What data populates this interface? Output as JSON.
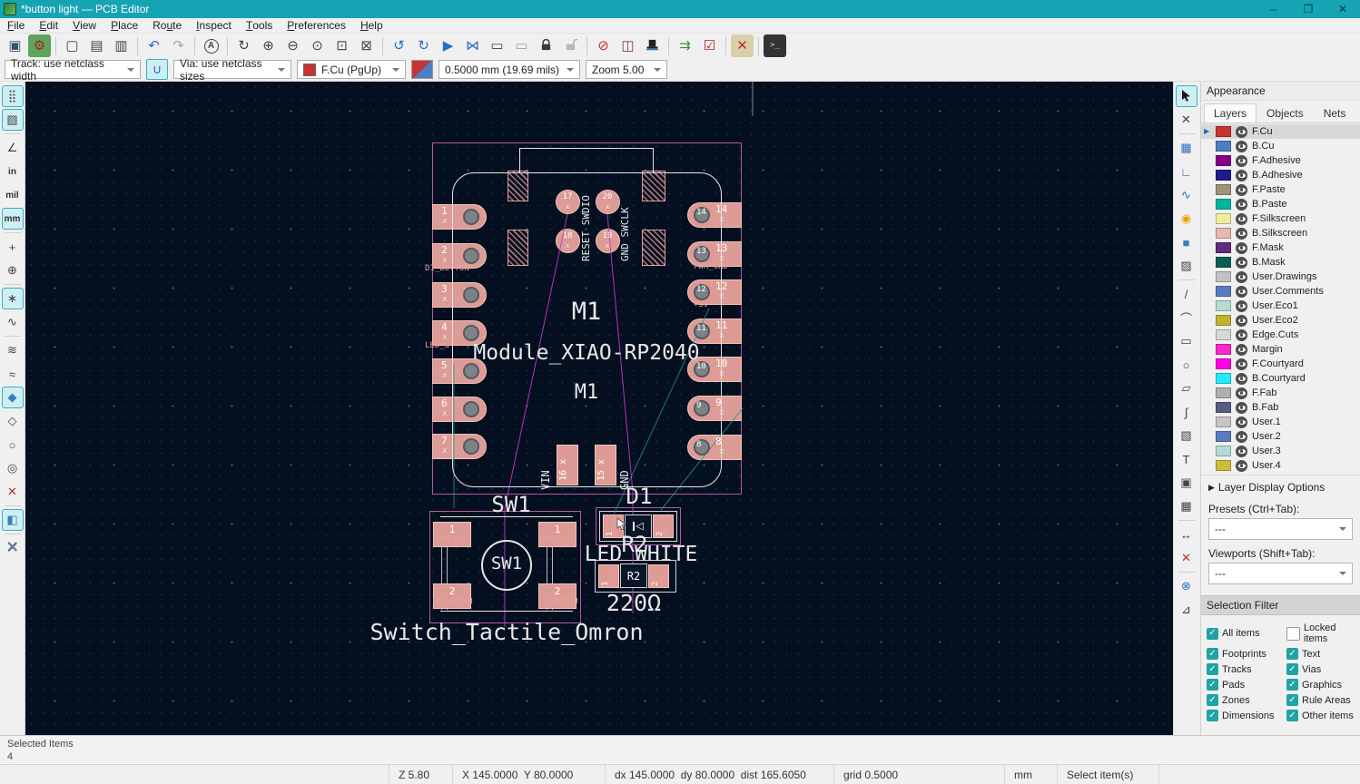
{
  "window": {
    "title": "*button light — PCB Editor",
    "minimize": "–",
    "maximize": "❐",
    "close": "✕"
  },
  "menubar": [
    {
      "label": "File",
      "u": 0
    },
    {
      "label": "Edit",
      "u": 0
    },
    {
      "label": "View",
      "u": 0
    },
    {
      "label": "Place",
      "u": 0
    },
    {
      "label": "Route",
      "u": 2
    },
    {
      "label": "Inspect",
      "u": 0
    },
    {
      "label": "Tools",
      "u": 0
    },
    {
      "label": "Preferences",
      "u": 0
    },
    {
      "label": "Help",
      "u": 0
    }
  ],
  "toolbar_main": [
    {
      "name": "save",
      "glyph": "▣",
      "color": "#37536e"
    },
    {
      "name": "board-setup",
      "glyph": "⚙",
      "color": "#b02020",
      "bg": "#5da55d"
    },
    {
      "name": "page-settings",
      "glyph": "▢",
      "sep": true
    },
    {
      "name": "print",
      "glyph": "▤"
    },
    {
      "name": "plot",
      "glyph": "▥"
    },
    {
      "name": "undo",
      "glyph": "↶",
      "color": "#2b6cc4",
      "sep": true
    },
    {
      "name": "redo",
      "glyph": "↷",
      "disabled": true
    },
    {
      "name": "find",
      "glyph": "A",
      "circle": true,
      "sep": true
    },
    {
      "name": "refresh",
      "glyph": "↻",
      "sep": true
    },
    {
      "name": "zoom-in",
      "glyph": "⊕"
    },
    {
      "name": "zoom-out",
      "glyph": "⊖"
    },
    {
      "name": "zoom-fit",
      "glyph": "⊙"
    },
    {
      "name": "zoom-objects",
      "glyph": "⊡"
    },
    {
      "name": "zoom-selection",
      "glyph": "⊠"
    },
    {
      "name": "rotate-ccw",
      "glyph": "↺",
      "color": "#2b6cc4",
      "sep": true
    },
    {
      "name": "rotate-cw",
      "glyph": "↻",
      "color": "#2b6cc4"
    },
    {
      "name": "flip-board-view",
      "glyph": "▶",
      "color": "#2b6cc4"
    },
    {
      "name": "mirror",
      "glyph": "⋈",
      "color": "#2b6cc4"
    },
    {
      "name": "group",
      "glyph": "▭"
    },
    {
      "name": "ungroup",
      "glyph": "▭",
      "disabled": true
    },
    {
      "name": "lock",
      "svg": "lock"
    },
    {
      "name": "unlock",
      "svg": "unlock"
    },
    {
      "name": "hide-drawing-sheet",
      "glyph": "⊘",
      "color": "#c03030",
      "sep": true
    },
    {
      "name": "footprint-library-browser",
      "glyph": "◫",
      "color": "#8c3a3a"
    },
    {
      "name": "footprint-wizard",
      "svg": "tophat"
    },
    {
      "name": "update-pcb-from-schematic",
      "glyph": "⇉",
      "color": "#3a8f3a",
      "sep": true
    },
    {
      "name": "design-rules-check",
      "glyph": "☑",
      "color": "#b02020"
    },
    {
      "name": "interactive-router-settings",
      "glyph": "✕",
      "color": "#b03030",
      "bg": "#d9cfa9",
      "sep": true
    },
    {
      "name": "scripting-console",
      "glyph": ">_",
      "color": "#9fe89f",
      "bg": "#333333",
      "sep": true
    }
  ],
  "toolbar_options": {
    "track_dropdown": "Track: use netclass width",
    "posture_button_glyph": "∪",
    "via_dropdown": "Via: use netclass sizes",
    "layer_dropdown": "F.Cu (PgUp)",
    "layer_swatch_color": "#c83232",
    "width_dropdown": "0.5000 mm (19.69 mils)",
    "zoom_dropdown": "Zoom 5.00"
  },
  "left_toolbar": [
    {
      "name": "grid-visibility",
      "glyph": "⣿",
      "active": true
    },
    {
      "name": "grid-overrides",
      "glyph": "▨",
      "active": true
    },
    {
      "name": "polar-coordinates",
      "glyph": "∠",
      "sep": true
    },
    {
      "name": "units-inches",
      "text": "in"
    },
    {
      "name": "units-mils",
      "text": "mil"
    },
    {
      "name": "units-mm",
      "text": "mm",
      "active": true
    },
    {
      "name": "cursor-shape",
      "glyph": "+",
      "sep": true
    },
    {
      "name": "full-window-crosshair",
      "glyph": "⊕"
    },
    {
      "name": "ratsnest-visibility",
      "glyph": "∗",
      "active": true,
      "sep": true
    },
    {
      "name": "curved-ratsnest",
      "glyph": "∿"
    },
    {
      "name": "net-color-mode",
      "glyph": "≋",
      "sep": true
    },
    {
      "name": "sketch-tracks",
      "glyph": "≈"
    },
    {
      "name": "zone-display-filled",
      "glyph": "◆",
      "color": "#3a7dbf",
      "active": true
    },
    {
      "name": "zone-display-outline",
      "glyph": "◇"
    },
    {
      "name": "pad-display-mode",
      "glyph": "○"
    },
    {
      "name": "via-display-mode",
      "glyph": "◎"
    },
    {
      "name": "track-display-mode",
      "glyph": "✕",
      "color": "#b03030"
    },
    {
      "name": "high-contrast-mode",
      "glyph": "◧",
      "color": "#3a7dbf",
      "active": true,
      "sep": true
    },
    {
      "name": "properties-manager",
      "svg": "tools",
      "sep": true
    }
  ],
  "right_toolbar": [
    {
      "name": "select-tool",
      "svg": "cursor",
      "active": true
    },
    {
      "name": "local-ratsnest",
      "glyph": "✕"
    },
    {
      "name": "place-footprint",
      "glyph": "▦",
      "color": "#2b6cc4",
      "sep": true
    },
    {
      "name": "route-tracks",
      "glyph": "∟",
      "color": "#2b6cc4"
    },
    {
      "name": "tune-length",
      "glyph": "∿",
      "color": "#2b6cc4"
    },
    {
      "name": "place-via",
      "glyph": "◉",
      "color": "#e8a000"
    },
    {
      "name": "draw-zone",
      "glyph": "■",
      "color": "#3a7dbf"
    },
    {
      "name": "draw-rule-area",
      "glyph": "▨"
    },
    {
      "name": "draw-line",
      "glyph": "/",
      "sep": true
    },
    {
      "name": "draw-arc",
      "glyph": "⌒"
    },
    {
      "name": "draw-rectangle",
      "glyph": "▭"
    },
    {
      "name": "draw-circle",
      "glyph": "○"
    },
    {
      "name": "draw-polygon",
      "glyph": "▱"
    },
    {
      "name": "draw-bezier",
      "glyph": "∫"
    },
    {
      "name": "place-image",
      "glyph": "▧"
    },
    {
      "name": "place-text",
      "glyph": "T"
    },
    {
      "name": "place-textbox",
      "glyph": "▣"
    },
    {
      "name": "place-table",
      "glyph": "▦"
    },
    {
      "name": "add-dimension",
      "glyph": "↔",
      "sep": true
    },
    {
      "name": "delete-tool",
      "glyph": "✕",
      "color": "#b03030"
    },
    {
      "name": "grid-origin",
      "glyph": "⊗",
      "color": "#2b6cc4",
      "sep": true
    },
    {
      "name": "measure-tool",
      "glyph": "⊿"
    }
  ],
  "colors": {
    "titlebar": "#16a3b4",
    "canvas_bg": "#041020",
    "pad": "#dd9b95",
    "courtyard": "#b557a8",
    "silk_white": "#e6e6e6",
    "ratsnest_magenta": "#c837c8",
    "ratsnest_teal": "#2f8f8f",
    "net_label_pink": "#e8a0a0"
  },
  "canvas": {
    "module": {
      "ref": "M1",
      "value": "Module_XIAO-RP2040",
      "ref2": "M1",
      "left_pads": [
        {
          "num": "1",
          "net": "x"
        },
        {
          "num": "2",
          "net": "D1_BUTTON"
        },
        {
          "num": "3",
          "net": "x"
        },
        {
          "num": "4",
          "net": "LED_G"
        },
        {
          "num": "5",
          "net": "x"
        },
        {
          "num": "6",
          "net": "x"
        },
        {
          "num": "7",
          "net": "x"
        }
      ],
      "right_pads": [
        {
          "num": "14",
          "net": "x"
        },
        {
          "num": "13",
          "net": "PWR_GND"
        },
        {
          "num": "12",
          "net": "+5V"
        },
        {
          "num": "11",
          "net": "x"
        },
        {
          "num": "10",
          "net": "x"
        },
        {
          "num": "9",
          "net": "x"
        },
        {
          "num": "8",
          "net": "x"
        }
      ],
      "center_pads": [
        {
          "num": "17"
        },
        {
          "num": "20"
        },
        {
          "num": "18"
        },
        {
          "num": "19"
        }
      ],
      "center_labels": [
        "RESET SWDIO",
        "GND  SWCLK"
      ],
      "bottom_pads": [
        {
          "num": "16",
          "label": "VIN"
        },
        {
          "num": "15",
          "label": "GND"
        }
      ]
    },
    "switch": {
      "ref": "SW1",
      "value": "Switch_Tactile_Omron",
      "circle_text": "SW1",
      "pads": [
        {
          "num": "1",
          "net": "PWR_GND"
        },
        {
          "num": "1",
          "net": "PWR_GND"
        },
        {
          "num": "2",
          "net": "D1_BUTTON"
        },
        {
          "num": "2",
          "net": "D1_BUTTON"
        }
      ]
    },
    "led": {
      "ref": "D1",
      "value": "LED WHITE",
      "pads": [
        {
          "num": "1",
          "net": "PWR_GND"
        },
        {
          "num": "2",
          "net": "LED"
        }
      ]
    },
    "resistor": {
      "ref": "R2",
      "body": "R2",
      "value": "220Ω",
      "pads": [
        {
          "num": "1",
          "net": "LED_G"
        },
        {
          "num": "2",
          "net": "LED"
        }
      ]
    }
  },
  "appearance": {
    "title": "Appearance",
    "tabs": [
      "Layers",
      "Objects",
      "Nets"
    ],
    "selected_tab": "Layers",
    "selected_layer": "F.Cu",
    "layers": [
      {
        "name": "F.Cu",
        "color": "#c83232"
      },
      {
        "name": "B.Cu",
        "color": "#4d7fc4"
      },
      {
        "name": "F.Adhesive",
        "color": "#840084"
      },
      {
        "name": "B.Adhesive",
        "color": "#1c1c8c"
      },
      {
        "name": "F.Paste",
        "color": "#9e9276"
      },
      {
        "name": "B.Paste",
        "color": "#00b5a0"
      },
      {
        "name": "F.Silkscreen",
        "color": "#f0ec9e"
      },
      {
        "name": "B.Silkscreen",
        "color": "#e9b7ac"
      },
      {
        "name": "F.Mask",
        "color": "#602a80"
      },
      {
        "name": "B.Mask",
        "color": "#0a5f50"
      },
      {
        "name": "User.Drawings",
        "color": "#c2c2c2"
      },
      {
        "name": "User.Comments",
        "color": "#577cc0"
      },
      {
        "name": "User.Eco1",
        "color": "#b5dcd2"
      },
      {
        "name": "User.Eco2",
        "color": "#c0b42e"
      },
      {
        "name": "Edge.Cuts",
        "color": "#d6d8d4"
      },
      {
        "name": "Margin",
        "color": "#ff26c8"
      },
      {
        "name": "F.Courtyard",
        "color": "#ff00e6"
      },
      {
        "name": "B.Courtyard",
        "color": "#22e9ff"
      },
      {
        "name": "F.Fab",
        "color": "#afafaf"
      },
      {
        "name": "B.Fab",
        "color": "#565b84"
      },
      {
        "name": "User.1",
        "color": "#c4c4c4"
      },
      {
        "name": "User.2",
        "color": "#577cc0"
      },
      {
        "name": "User.3",
        "color": "#b5dcd2"
      },
      {
        "name": "User.4",
        "color": "#cbbc3a"
      }
    ],
    "layer_display_options": "Layer Display Options",
    "presets_label": "Presets (Ctrl+Tab):",
    "presets_value": "---",
    "viewports_label": "Viewports (Shift+Tab):",
    "viewports_value": "---"
  },
  "selection_filter": {
    "title": "Selection Filter",
    "items": [
      {
        "label": "All items",
        "checked": true
      },
      {
        "label": "Locked items",
        "checked": false
      },
      {
        "label": "Footprints",
        "checked": true
      },
      {
        "label": "Text",
        "checked": true
      },
      {
        "label": "Tracks",
        "checked": true
      },
      {
        "label": "Vias",
        "checked": true
      },
      {
        "label": "Pads",
        "checked": true
      },
      {
        "label": "Graphics",
        "checked": true
      },
      {
        "label": "Zones",
        "checked": true
      },
      {
        "label": "Rule Areas",
        "checked": true
      },
      {
        "label": "Dimensions",
        "checked": true
      },
      {
        "label": "Other items",
        "checked": true
      }
    ]
  },
  "message_panel": {
    "title": "Selected Items",
    "value": "4"
  },
  "status_bar": {
    "zoom": "Z 5.80",
    "position": "X 145.0000  Y 80.0000",
    "delta": "dx 145.0000  dy 80.0000  dist 165.6050",
    "grid": "grid 0.5000",
    "units": "mm",
    "hint": "Select item(s)"
  }
}
